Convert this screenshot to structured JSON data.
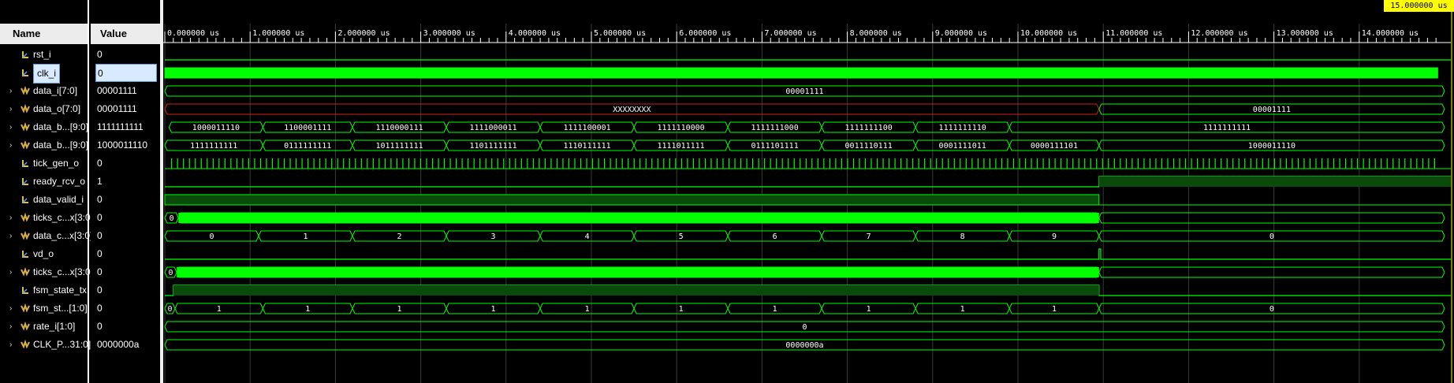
{
  "headers": {
    "name": "Name",
    "value": "Value"
  },
  "cursor_time": "15.000000 us",
  "ticks": [
    "0.000000 us",
    "1.000000 us",
    "2.000000 us",
    "3.000000 us",
    "4.000000 us",
    "5.000000 us",
    "6.000000 us",
    "7.000000 us",
    "8.000000 us",
    "9.000000 us",
    "10.000000 us",
    "11.000000 us",
    "12.000000 us",
    "13.000000 us",
    "14.000000 us"
  ],
  "signals": [
    {
      "name": "rst_i",
      "value": "0",
      "bus": false
    },
    {
      "name": "clk_i",
      "value": "0",
      "bus": false,
      "selected": true
    },
    {
      "name": "data_i[7:0]",
      "value": "00001111",
      "bus": true
    },
    {
      "name": "data_o[7:0]",
      "value": "00001111",
      "bus": true
    },
    {
      "name": "data_b...[9:0]",
      "value": "1111111111",
      "bus": true
    },
    {
      "name": "data_b...[9:0]",
      "value": "1000011110",
      "bus": true
    },
    {
      "name": "tick_gen_o",
      "value": "0",
      "bus": false
    },
    {
      "name": "ready_rcv_o",
      "value": "1",
      "bus": false
    },
    {
      "name": "data_valid_i",
      "value": "0",
      "bus": false
    },
    {
      "name": "ticks_c...x[3:0]",
      "value": "0",
      "bus": true
    },
    {
      "name": "data_c...x[3:0]",
      "value": "0",
      "bus": true
    },
    {
      "name": "vd_o",
      "value": "0",
      "bus": false
    },
    {
      "name": "ticks_c...x[3:0]",
      "value": "0",
      "bus": true
    },
    {
      "name": "fsm_state_tx",
      "value": "0",
      "bus": false
    },
    {
      "name": "fsm_st...[1:0]",
      "value": "0",
      "bus": true
    },
    {
      "name": "rate_i[1:0]",
      "value": "0",
      "bus": true
    },
    {
      "name": "CLK_P...31:0]",
      "value": "0000000a",
      "bus": true
    }
  ],
  "segments": {
    "data_i": [
      "00001111"
    ],
    "data_o": [
      "XXXXXXXX",
      "00001111"
    ],
    "data_b1": [
      "1000011110",
      "1100001111",
      "1110000111",
      "1111000011",
      "1111100001",
      "1111110000",
      "1111111000",
      "1111111100",
      "1111111110",
      "1111111111"
    ],
    "data_b2": [
      "1111111111",
      "0111111111",
      "1011111111",
      "1101111111",
      "1110111111",
      "1111011111",
      "0111101111",
      "0011110111",
      "0001111011",
      "0000111101",
      "1000011110"
    ],
    "ticks1": [
      "0",
      "0"
    ],
    "data_c": [
      "0",
      "1",
      "2",
      "3",
      "4",
      "5",
      "6",
      "7",
      "8",
      "9",
      "0"
    ],
    "ticks2": [
      "0",
      "0"
    ],
    "fsm_st": [
      "0",
      "1",
      "1",
      "1",
      "1",
      "1",
      "1",
      "1",
      "1",
      "1",
      "1",
      "0"
    ],
    "rate_i": [
      "0"
    ],
    "clk_p": [
      "0000000a"
    ]
  },
  "colors": {
    "wave": "#00ff00",
    "bg": "#000000",
    "x_state": "#d02020",
    "grid": "#3a3a3a"
  }
}
